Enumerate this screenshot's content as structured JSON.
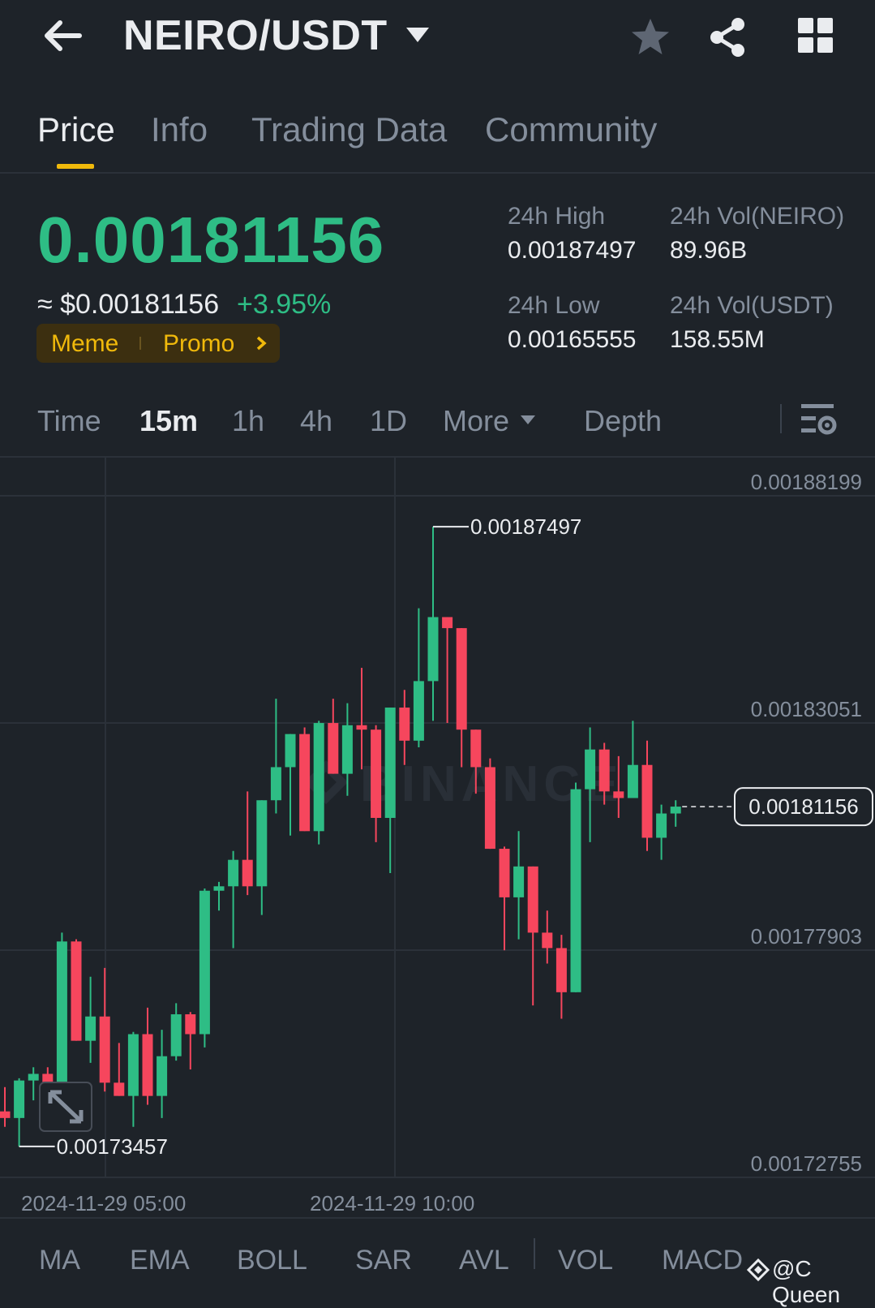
{
  "header": {
    "pair": "NEIRO/USDT"
  },
  "tabs": [
    {
      "label": "Price"
    },
    {
      "label": "Info"
    },
    {
      "label": "Trading Data"
    },
    {
      "label": "Community"
    }
  ],
  "ticker": {
    "last_price": "0.00181156",
    "usd_price": "≈ $0.00181156",
    "change_pct": "+3.95%",
    "tags": [
      "Meme",
      "Promo"
    ],
    "stats": {
      "high_label": "24h High",
      "high_value": "0.00187497",
      "low_label": "24h Low",
      "low_value": "0.00165555",
      "vol_base_label": "24h Vol(NEIRO)",
      "vol_base_value": "89.96B",
      "vol_quote_label": "24h Vol(USDT)",
      "vol_quote_value": "158.55M"
    }
  },
  "intervals": {
    "items": [
      "Time",
      "15m",
      "1h",
      "4h",
      "1D"
    ],
    "active": "15m",
    "more": "More",
    "depth": "Depth"
  },
  "chart_data": {
    "type": "candlestick",
    "y_ticks": [
      "0.00188199",
      "0.00183051",
      "0.00177903",
      "0.00172755"
    ],
    "x_ticks": [
      "2024-11-29 05:00",
      "2024-11-29 10:00"
    ],
    "ylim": [
      0.00172755,
      0.00188199
    ],
    "high_label": "0.00187497",
    "low_label": "0.00173457",
    "last_price_label": "0.00181156",
    "up_color": "#2ebd85",
    "down_color": "#f6465d",
    "candles": [
      [
        0.0017425,
        0.001748,
        0.001739,
        0.001741
      ],
      [
        0.001741,
        0.00175,
        0.00173457,
        0.0017495
      ],
      [
        0.0017495,
        0.0017525,
        0.001745,
        0.001751
      ],
      [
        0.001751,
        0.0017525,
        0.001744,
        0.0017455
      ],
      [
        0.0017455,
        0.001783,
        0.001743,
        0.001781
      ],
      [
        0.001781,
        0.0017815,
        0.001759,
        0.0017585
      ],
      [
        0.0017585,
        0.001773,
        0.0017535,
        0.001764
      ],
      [
        0.001764,
        0.001775,
        0.001747,
        0.001749
      ],
      [
        0.001749,
        0.001758,
        0.001746,
        0.001746
      ],
      [
        0.001746,
        0.0017605,
        0.001739,
        0.00176
      ],
      [
        0.00176,
        0.001766,
        0.001744,
        0.001746
      ],
      [
        0.001746,
        0.001761,
        0.001741,
        0.001755
      ],
      [
        0.001755,
        0.001767,
        0.001754,
        0.0017645
      ],
      [
        0.0017645,
        0.001765,
        0.001752,
        0.00176
      ],
      [
        0.00176,
        0.001793,
        0.001757,
        0.0017925
      ],
      [
        0.0017925,
        0.0017945,
        0.001788,
        0.0017935
      ],
      [
        0.0017935,
        0.0018015,
        0.0017795,
        0.0017995
      ],
      [
        0.0017995,
        0.001815,
        0.0017915,
        0.0017935
      ],
      [
        0.0017935,
        0.0018035,
        0.001787,
        0.001813
      ],
      [
        0.001813,
        0.001836,
        0.00181,
        0.0018205
      ],
      [
        0.0018205,
        0.0018225,
        0.001805,
        0.001828
      ],
      [
        0.001828,
        0.0018295,
        0.001806,
        0.001806
      ],
      [
        0.001806,
        0.001831,
        0.001803,
        0.0018305
      ],
      [
        0.0018305,
        0.001836,
        0.001819,
        0.001819
      ],
      [
        0.001819,
        0.001835,
        0.001814,
        0.00183
      ],
      [
        0.00183,
        0.001843,
        0.00182,
        0.001829
      ],
      [
        0.001829,
        0.00183,
        0.0018035,
        0.001809
      ],
      [
        0.001809,
        0.0018325,
        0.0017965,
        0.001834
      ],
      [
        0.001834,
        0.001838,
        0.001821,
        0.0018265
      ],
      [
        0.0018265,
        0.0018565,
        0.001825,
        0.00184
      ],
      [
        0.00184,
        0.00187497,
        0.001831,
        0.0018545
      ],
      [
        0.0018545,
        0.001847,
        0.0018305,
        0.001852
      ],
      [
        0.001852,
        0.0018485,
        0.0018205,
        0.001829
      ],
      [
        0.001829,
        0.0018235,
        0.0018145,
        0.0018205
      ],
      [
        0.0018205,
        0.0018225,
        0.001805,
        0.001802
      ],
      [
        0.001802,
        0.0018025,
        0.001779,
        0.001791
      ],
      [
        0.001791,
        0.001806,
        0.0017815,
        0.001798
      ],
      [
        0.001798,
        0.001798,
        0.0017665,
        0.001783
      ],
      [
        0.001783,
        0.001788,
        0.001776,
        0.0017795
      ],
      [
        0.0017795,
        0.0017825,
        0.0017635,
        0.0017695
      ],
      [
        0.0017695,
        0.001817,
        0.0017695,
        0.0018155
      ],
      [
        0.0018155,
        0.0018295,
        0.0018035,
        0.0018245
      ],
      [
        0.0018245,
        0.001826,
        0.001812,
        0.001815
      ],
      [
        0.001815,
        0.001823,
        0.001809,
        0.0018135
      ],
      [
        0.0018135,
        0.001831,
        0.001815,
        0.001821
      ],
      [
        0.001821,
        0.0018265,
        0.0018015,
        0.0018045
      ],
      [
        0.0018045,
        0.001812,
        0.0017995,
        0.00181
      ],
      [
        0.00181,
        0.001813,
        0.001807,
        0.00181156
      ]
    ]
  },
  "indicators": [
    "MA",
    "EMA",
    "BOLL",
    "SAR",
    "AVL",
    "VOL",
    "MACD"
  ],
  "watermark": "@C Queen"
}
